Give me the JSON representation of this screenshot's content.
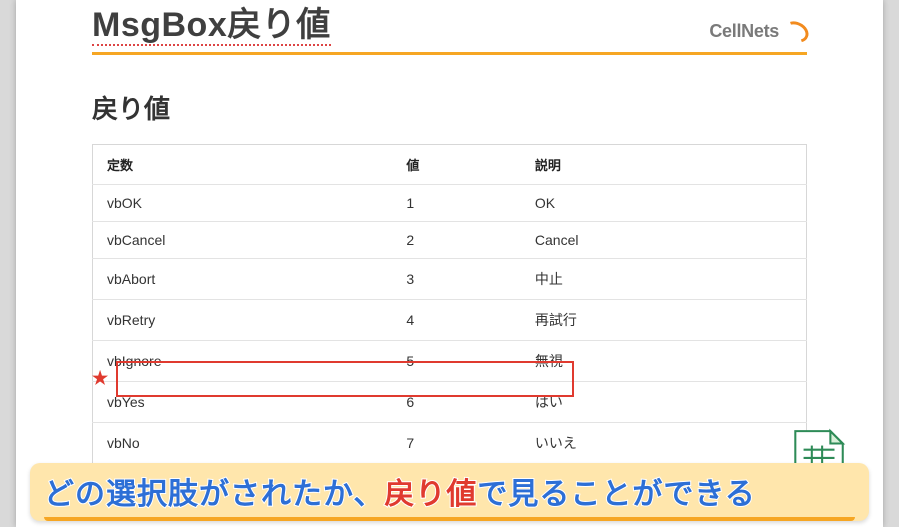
{
  "header": {
    "title": "MsgBox戻り値",
    "logo_text": "CellNets"
  },
  "subheading": "戻り値",
  "table": {
    "headers": {
      "const": "定数",
      "value": "値",
      "desc": "説明"
    },
    "rows": [
      {
        "const": "vbOK",
        "value": "1",
        "desc": "OK"
      },
      {
        "const": "vbCancel",
        "value": "2",
        "desc": "Cancel"
      },
      {
        "const": "vbAbort",
        "value": "3",
        "desc": "中止"
      },
      {
        "const": "vbRetry",
        "value": "4",
        "desc": "再試行"
      },
      {
        "const": "vbIgnore",
        "value": "5",
        "desc": "無視"
      },
      {
        "const": "vbYes",
        "value": "6",
        "desc": "はい"
      },
      {
        "const": "vbNo",
        "value": "7",
        "desc": "いいえ"
      }
    ],
    "highlighted_index": 5
  },
  "star": "★",
  "caption": {
    "part1": "どの選択肢がされたか、",
    "part2": "戻り値",
    "part3": "で見ることができる"
  }
}
